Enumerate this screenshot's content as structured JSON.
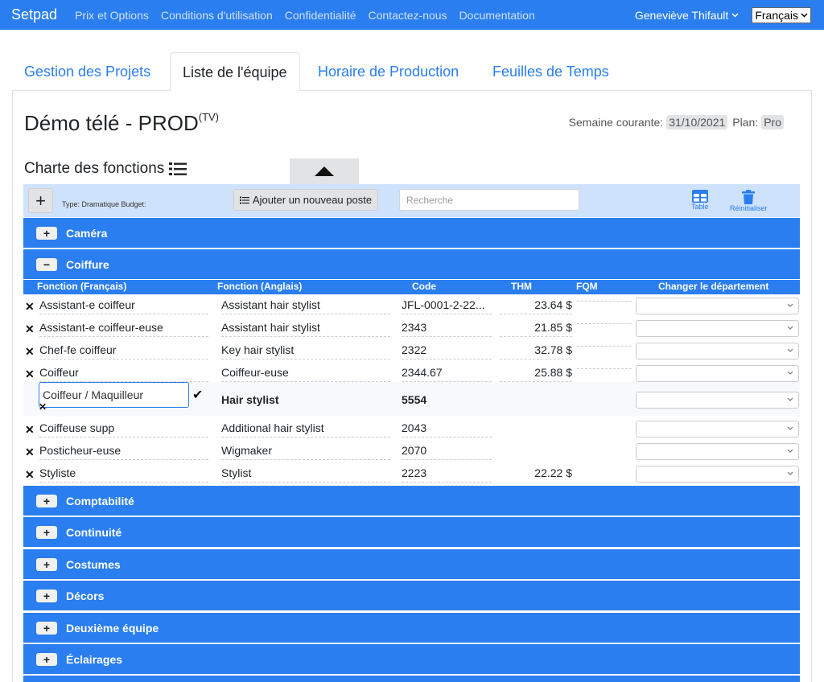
{
  "navbar": {
    "brand": "Setpad",
    "links": [
      "Prix et Options",
      "Conditions d'utilisation",
      "Confidentialité",
      "Contactez-nous",
      "Documentation"
    ],
    "user": "Geneviève Thifault",
    "language": "Français"
  },
  "tabs": [
    {
      "label": "Gestion des Projets",
      "active": false
    },
    {
      "label": "Liste de l'équipe",
      "active": true
    },
    {
      "label": "Horaire de Production",
      "active": false
    },
    {
      "label": "Feuilles de Temps",
      "active": false
    }
  ],
  "project": {
    "title": "Démo télé - PROD",
    "badge": "(TV)",
    "week_label": "Semaine courante:",
    "week_value": "31/10/2021",
    "plan_label": "Plan:",
    "plan_value": "Pro"
  },
  "chart": {
    "title": "Charte des fonctions"
  },
  "toolbar": {
    "add": "+",
    "type_text": "Type: Dramatique  Budget:",
    "new_post": "Ajouter un nouveau poste",
    "search_placeholder": "Recherche",
    "table_label": "Table",
    "reset_label": "Réinitialiser"
  },
  "departments": [
    {
      "label": "Caméra",
      "expanded": false
    },
    {
      "label": "Coiffure",
      "expanded": true
    },
    {
      "label": "Comptabilité",
      "expanded": false
    },
    {
      "label": "Continuité",
      "expanded": false
    },
    {
      "label": "Costumes",
      "expanded": false
    },
    {
      "label": "Décors",
      "expanded": false
    },
    {
      "label": "Deuxième équipe",
      "expanded": false
    },
    {
      "label": "Éclairages",
      "expanded": false
    }
  ],
  "columns": {
    "fr": "Fonction (Français)",
    "en": "Fonction (Anglais)",
    "code": "Code",
    "thm": "THM",
    "fqm": "FQM",
    "dept": "Changer le département"
  },
  "rows": [
    {
      "fr": "Assistant-e coiffeur",
      "en": "Assistant hair stylist",
      "code": "JFL-0001-2-22...",
      "thm": "23.64 $"
    },
    {
      "fr": "Assistant-e coiffeur-euse",
      "en": "Assistant hair stylist",
      "code": "2343",
      "thm": "21.85 $"
    },
    {
      "fr": "Chef-fe coiffeur",
      "en": "Key hair stylist",
      "code": "2322",
      "thm": "32.78 $"
    },
    {
      "fr": "Coiffeur",
      "en": "Coiffeur-euse",
      "code": "2344.67",
      "thm": "25.88 $"
    },
    {
      "fr": "Coiffeur / Maquilleur",
      "en": "Hair stylist",
      "code": "5554",
      "thm": ""
    },
    {
      "fr": "Coiffeuse supp",
      "en": "Additional hair stylist",
      "code": "2043",
      "thm": ""
    },
    {
      "fr": "Posticheur-euse",
      "en": "Wigmaker",
      "code": "2070",
      "thm": ""
    },
    {
      "fr": "Styliste",
      "en": "Stylist",
      "code": "2223",
      "thm": "22.22 $"
    }
  ],
  "glyphs": {
    "remove": "✕",
    "confirm": "✔",
    "plus": "+",
    "minus": "−"
  },
  "colors": {
    "primary": "#2a7ef0",
    "toolbar_bg": "#cfe2fc"
  }
}
